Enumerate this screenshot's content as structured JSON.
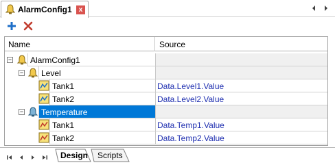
{
  "document_tab": {
    "title": "AlarmConfig1",
    "close_glyph": "x"
  },
  "toolbar": {
    "add_icon": "plus-icon",
    "delete_icon": "delete-x-icon"
  },
  "columns": {
    "name": "Name",
    "source": "Source"
  },
  "tree": {
    "root": {
      "label": "AlarmConfig1",
      "expander": "−"
    },
    "level": {
      "label": "Level",
      "expander": "−"
    },
    "level_tank1": {
      "label": "Tank1",
      "source": "Data.Level1.Value"
    },
    "level_tank2": {
      "label": "Tank2",
      "source": "Data.Level2.Value"
    },
    "temperature": {
      "label": "Temperature",
      "expander": "−"
    },
    "temp_tank1": {
      "label": "Tank1",
      "source": "Data.Temp1.Value"
    },
    "temp_tank2": {
      "label": "Tank2",
      "source": "Data.Temp2.Value"
    }
  },
  "bottom_tabs": {
    "design": "Design",
    "scripts": "Scripts"
  },
  "colors": {
    "selection": "#0078d7",
    "source_text": "#1f2fb0",
    "close_button": "#d9534f",
    "add_icon": "#1e6fc8",
    "delete_icon": "#c0392b"
  }
}
